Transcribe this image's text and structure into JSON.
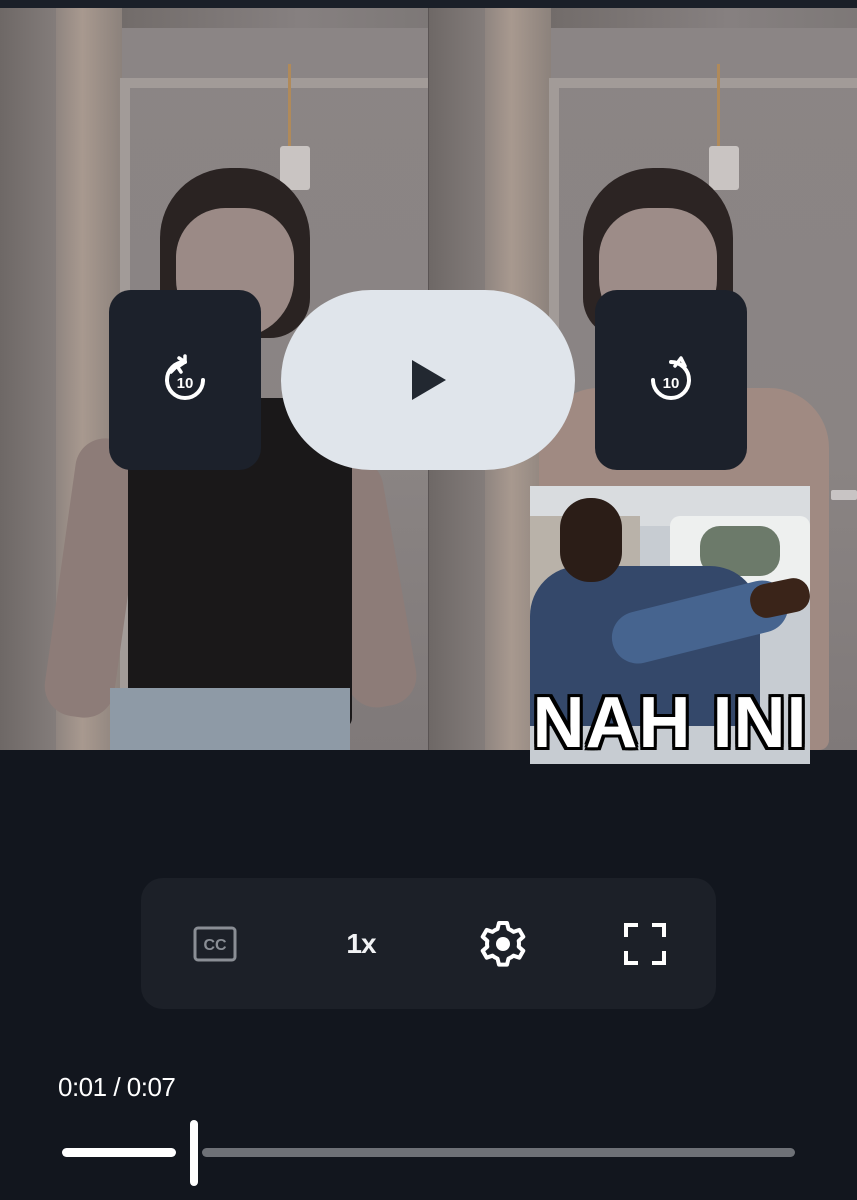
{
  "player": {
    "rewind_seconds": "10",
    "forward_seconds": "10",
    "playing": false
  },
  "sticker": {
    "caption": "NAH INI"
  },
  "toolbar": {
    "cc_label": "CC",
    "speed_label": "1x"
  },
  "progress": {
    "time_display": "0:01 / 0:07",
    "fraction": 0.18
  },
  "colors": {
    "background": "#12161e",
    "control_bg": "#1c2028",
    "play_button": "#e0e5eb",
    "track": "#6e7177",
    "fill": "#ffffff"
  },
  "icons": [
    "rewind-10-icon",
    "play-icon",
    "forward-10-icon",
    "closed-captions-icon",
    "gear-icon",
    "fullscreen-icon"
  ]
}
